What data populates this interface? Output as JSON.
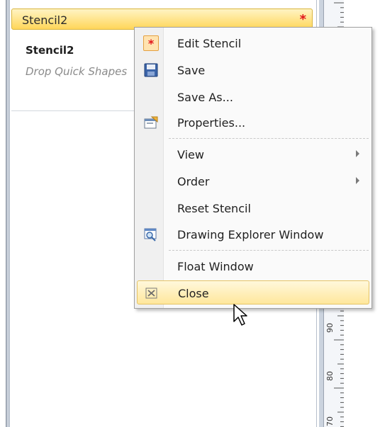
{
  "stencil": {
    "header_title": "Stencil2",
    "modified_marker": "*",
    "name": "Stencil2",
    "drop_hint": "Drop Quick Shapes"
  },
  "ruler": {
    "labels": [
      "90",
      "80",
      "70"
    ]
  },
  "context_menu": {
    "items": [
      {
        "label": "Edit Stencil",
        "icon": "asterisk-icon"
      },
      {
        "label": "Save",
        "icon": "floppy-disk-icon"
      },
      {
        "label": "Save As...",
        "icon": null
      },
      {
        "label": "Properties...",
        "icon": "properties-icon"
      },
      {
        "label": "View",
        "icon": null,
        "submenu": true
      },
      {
        "label": "Order",
        "icon": null,
        "submenu": true
      },
      {
        "label": "Reset Stencil",
        "icon": null
      },
      {
        "label": "Drawing Explorer Window",
        "icon": "drawing-explorer-icon"
      },
      {
        "label": "Float Window",
        "icon": null
      },
      {
        "label": "Close",
        "icon": "close-x-icon",
        "highlighted": true
      }
    ]
  },
  "colors": {
    "header_gradient_top": "#fff4c4",
    "header_gradient_bottom": "#ffd65a",
    "modified_marker": "#e1141b",
    "hover_border": "#e5c365"
  }
}
